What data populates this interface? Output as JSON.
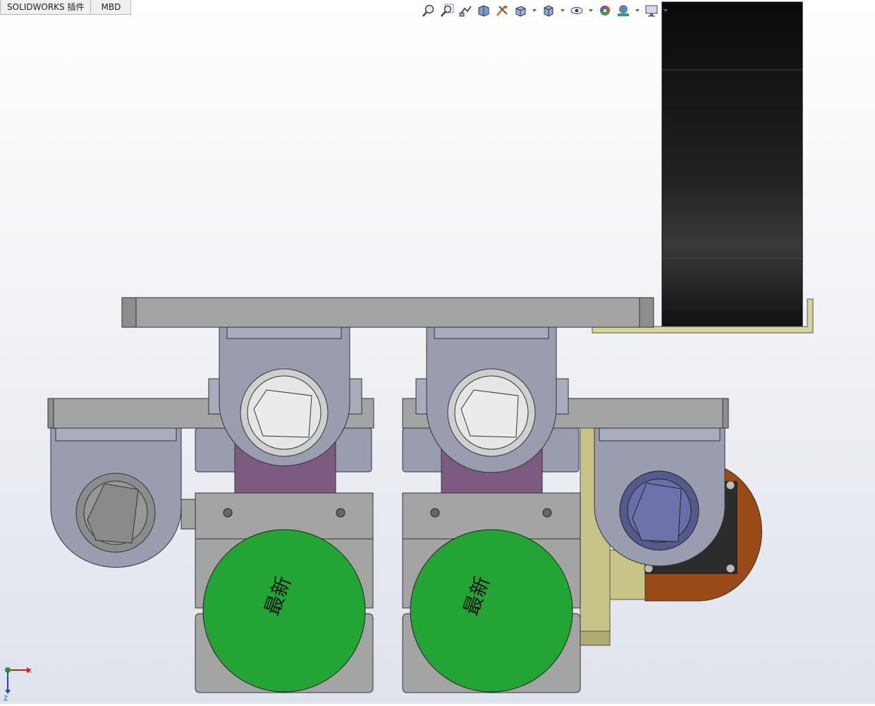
{
  "tabs": [
    "SOLIDWORKS 插件",
    "MBD"
  ],
  "hud_icons": [
    "zoom-to-fit-icon",
    "zoom-to-area-icon",
    "previous-view-icon",
    "section-view-icon",
    "dynamic-annotation-icon",
    "view-orientation-icon",
    "display-style-icon",
    "hide-show-items-icon",
    "edit-appearance-icon",
    "apply-scene-icon",
    "view-settings-icon"
  ],
  "model": {
    "wheel_text": "最新",
    "colors": {
      "gray_part": "#9a9db0",
      "base_plate": "#a0a0a0",
      "green_wheel": "#22a535",
      "purple_block": "#7d5a80",
      "black_motor": "#111111",
      "brass": "#c0bb7d",
      "copper": "#9a4a16",
      "blue_bearing": "#6a6ea8"
    }
  },
  "triad": {
    "x_label": "X",
    "z_label": "Z"
  }
}
